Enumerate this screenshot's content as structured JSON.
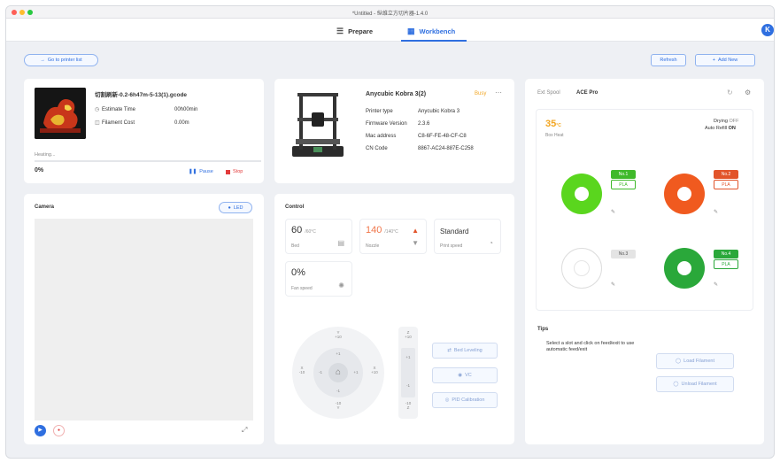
{
  "window": {
    "title": "*Untitled - 纵维立方切片器-1.4.0",
    "dots": [
      "#fe5f57",
      "#febc2e",
      "#28c840"
    ]
  },
  "tabs": [
    {
      "label": "Prepare",
      "icon": "layers-icon"
    },
    {
      "label": "Workbench",
      "icon": "grid-icon"
    }
  ],
  "avatar": {
    "letter": "K"
  },
  "toolbar": {
    "go_printer_list": "Go to printer list",
    "refresh": "Refresh",
    "add_new": "Add New"
  },
  "job": {
    "filename": "切割刷新-0.2-6h47m-5-13(1).gcode",
    "estimate_label": "Estimate Time",
    "estimate_value": "00h00min",
    "filament_label": "Filament Cost",
    "filament_value": "0.00m",
    "status": "Heating...",
    "progress_text": "0%",
    "progress": 0,
    "pause": "Pause",
    "stop": "Stop"
  },
  "printer": {
    "name": "Anycubic Kobra 3(2)",
    "status": "Busy",
    "fields": [
      {
        "label": "Printer type",
        "value": "Anycubic Kobra 3"
      },
      {
        "label": "Firmware Version",
        "value": "2.3.6"
      },
      {
        "label": "Mac address",
        "value": "C8-6F-FE-48-CF-C8"
      },
      {
        "label": "CN Code",
        "value": "8867-AC24-887E-C258"
      }
    ]
  },
  "camera": {
    "title": "Camera",
    "led": "LED"
  },
  "control": {
    "title": "Control",
    "bed": {
      "value": "60",
      "unit": "/60°C",
      "label": "Bed"
    },
    "nozzle": {
      "value": "140",
      "unit": "/140°C",
      "label": "Nozzle"
    },
    "print_speed": {
      "value": "Standard",
      "label": "Print speed"
    },
    "fan": {
      "value": "0%",
      "label": "Fan speed"
    },
    "jog": {
      "top": "Y\n+10",
      "bottom": "-10\nY",
      "left": "X\n-10",
      "right": "X\n+10",
      "inner_top": "+1",
      "inner_bottom": "-1",
      "inner_left": "-1",
      "inner_right": "+1"
    },
    "z": {
      "top": "Z\n+10",
      "mid_top": "+1",
      "mid_bottom": "-1",
      "bottom": "-10\nZ"
    },
    "bed_leveling": "Bed Leveling",
    "vc": "VC",
    "pid": "PID Calibration"
  },
  "ace": {
    "tab_ext": "Ext Spool",
    "tab_ace": "ACE Pro",
    "temp": "35",
    "temp_unit": "°C",
    "temp_label": "Box Heat",
    "drying_label": "Drying",
    "drying_value": "OFF",
    "autorefill_label": "Auto Refill",
    "autorefill_value": "ON",
    "slots": [
      {
        "name": "No.1",
        "type": "PLA",
        "color": "#5ad61e",
        "accent": "#3fb92a"
      },
      {
        "name": "No.2",
        "type": "PLA",
        "color": "#f05a1f",
        "accent": "#e2542a"
      },
      {
        "name": "No.3",
        "type": "",
        "color": "#ffffff",
        "accent": "#bbbbbb"
      },
      {
        "name": "No.4",
        "type": "PLA",
        "color": "#2aa83a",
        "accent": "#2aa83a"
      }
    ]
  },
  "tips": {
    "title": "Tips",
    "text": "Select a slot and click on feed/exit to use automatic feed/exit",
    "load": "Load Filament",
    "unload": "Unload Filament"
  }
}
